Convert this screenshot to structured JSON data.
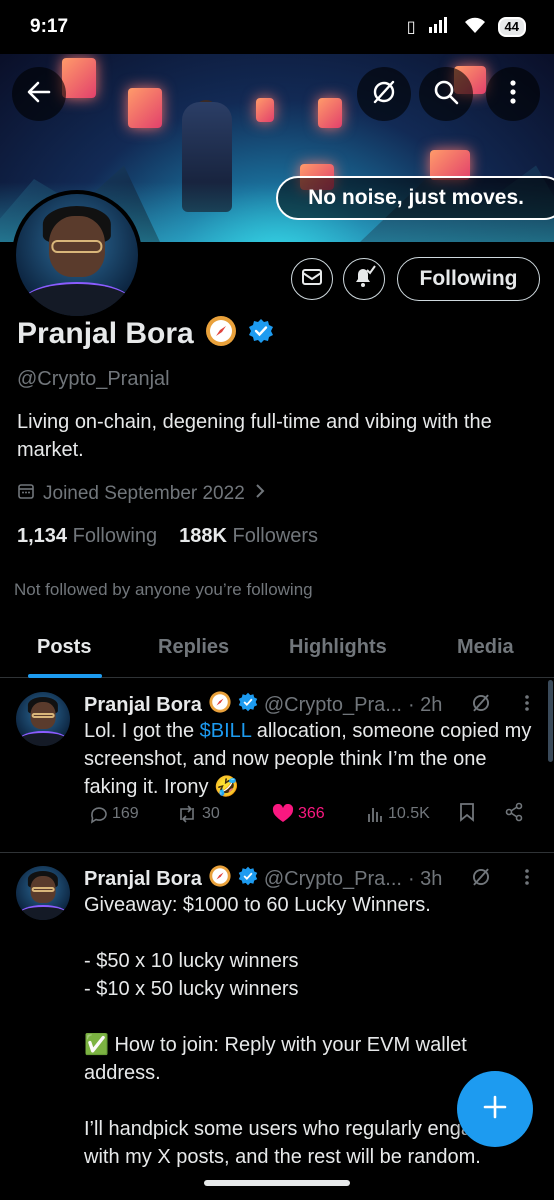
{
  "status_bar": {
    "time": "9:17",
    "battery": "44"
  },
  "banner": {
    "tagline": "No noise, just moves."
  },
  "profile": {
    "display_name": "Pranjal Bora",
    "handle": "@Crypto_Pranjal",
    "bio": "Living on-chain, degening full-time and vibing with the market.",
    "joined": "Joined September 2022",
    "following_count": "1,134",
    "following_label": "Following",
    "followers_count": "188K",
    "followers_label": "Followers",
    "not_followed_text": "Not followed by anyone you’re following",
    "follow_button_label": "Following"
  },
  "tabs": [
    "Posts",
    "Replies",
    "Highlights",
    "Media"
  ],
  "posts": [
    {
      "name": "Pranjal Bora",
      "handle": "@Crypto_Pra...",
      "time": "· 2h",
      "text_before": "Lol. I got the ",
      "cashtag": "$BILL",
      "text_after": " allocation, someone copied my screenshot, and now people think I’m the one faking it. Irony 🤣",
      "replies": "169",
      "reposts": "30",
      "likes": "366",
      "views": "10.5K"
    },
    {
      "name": "Pranjal Bora",
      "handle": "@Crypto_Pra...",
      "time": "· 3h",
      "text": "Giveaway: $1000 to 60 Lucky Winners.\n\n- $50 x 10 lucky winners\n- $10 x 50 lucky winners\n\n✅ How to join: Reply with your EVM wallet address.\n\nI’ll handpick some users who regularly engage with my X posts, and the rest will be random."
    }
  ],
  "colors": {
    "accent": "#1d9bf0",
    "like": "#f91880",
    "muted": "#71767b",
    "text": "#e7e9ea"
  }
}
